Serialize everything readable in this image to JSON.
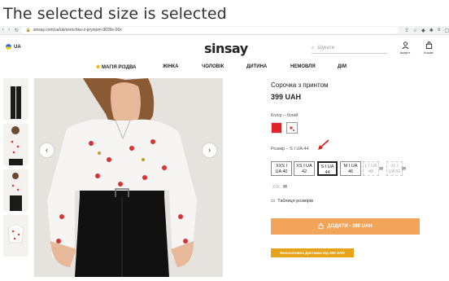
{
  "caption": "The selected size is selected",
  "browser": {
    "url": "sinsay.com/ua/uk/sorochka-z-pryntom-9039x-00x"
  },
  "header": {
    "lang": "UA",
    "logo": "sinsay",
    "search_placeholder": "Шукати",
    "account_label": "Акаунт",
    "cart_label": "Кошик"
  },
  "menu": {
    "items": [
      "МАГІЯ РІЗДВА",
      "ЖІНКА",
      "ЧОЛОВІК",
      "ДИТИНА",
      "НЕМОВЛЯ",
      "ДІМ"
    ]
  },
  "product": {
    "title": "Сорочка з принтом",
    "price": "399 UAH",
    "color_label": "Колір – білий",
    "size_label": "Розмір – S I UA 44",
    "sizes": [
      {
        "top": "XXS I",
        "bottom": "UA 40"
      },
      {
        "top": "XS I UA",
        "bottom": "42"
      },
      {
        "top": "S I UA",
        "bottom": "44"
      },
      {
        "top": "M I UA",
        "bottom": "46"
      },
      {
        "top": "L I UA",
        "bottom": "48"
      },
      {
        "top": "XL I",
        "bottom": "UA 50"
      },
      {
        "top": "XXL",
        "bottom": ""
      }
    ],
    "size_table": "Таблиця розмірів",
    "add_button": "ДОДАТИ - 399 UAH",
    "promo": "Безкоштовна Доставка від 400 UAH"
  },
  "colors": {
    "accent": "#f3a45b",
    "promo": "#e7a31a",
    "swatch_red": "#e0242b"
  }
}
